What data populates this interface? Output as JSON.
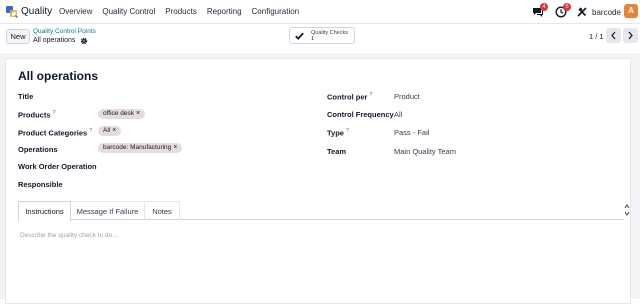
{
  "navbar": {
    "app_name": "Quality",
    "menu": [
      "Overview",
      "Quality Control",
      "Products",
      "Reporting",
      "Configuration"
    ],
    "messages_badge": "4",
    "activity_badge": "5",
    "company": "barcode",
    "avatar_letter": "A"
  },
  "control_panel": {
    "new_label": "New",
    "breadcrumb_parent": "Quality Control Points",
    "breadcrumb_current": "All operations",
    "smart_button_label": "Quality Checks",
    "smart_button_value": "1",
    "pager": "1 / 1"
  },
  "form": {
    "title": "All operations",
    "labels": {
      "title": "Title",
      "products": "Products",
      "product_categories": "Product Categories",
      "operations": "Operations",
      "work_order_operation": "Work Order Operation",
      "responsible": "Responsible",
      "control_per": "Control per",
      "control_frequency": "Control Frequency",
      "type": "Type",
      "team": "Team"
    },
    "help_marker": "?",
    "tags": {
      "product": "office desk",
      "category": "All",
      "operation": "barcode: Manufacturing"
    },
    "tag_remove": "×",
    "values": {
      "control_per": "Product",
      "control_frequency": "All",
      "type": "Pass - Fail",
      "team": "Main Quality Team"
    }
  },
  "tabs": [
    "Instructions",
    "Message If Failure",
    "Notes"
  ],
  "instructions_placeholder": "Describe the quality check to do...",
  "colors": {
    "accent": "#017e84",
    "badge": "#d9363e",
    "avatar": "#e8833a",
    "tag": "#e6dcdc"
  }
}
